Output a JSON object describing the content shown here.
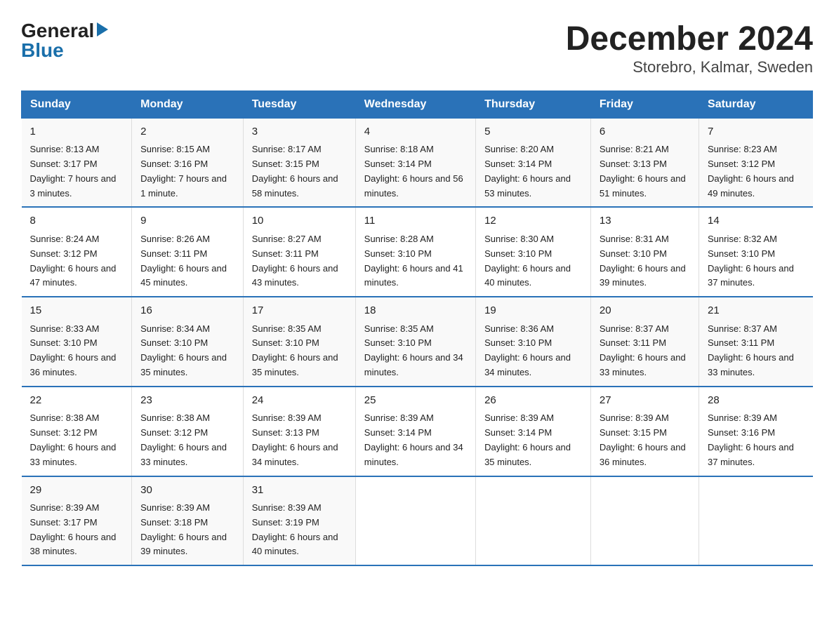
{
  "logo": {
    "general": "General",
    "blue": "Blue"
  },
  "title": "December 2024",
  "subtitle": "Storebro, Kalmar, Sweden",
  "days_of_week": [
    "Sunday",
    "Monday",
    "Tuesday",
    "Wednesday",
    "Thursday",
    "Friday",
    "Saturday"
  ],
  "weeks": [
    [
      {
        "day": "1",
        "sunrise": "8:13 AM",
        "sunset": "3:17 PM",
        "daylight": "7 hours and 3 minutes."
      },
      {
        "day": "2",
        "sunrise": "8:15 AM",
        "sunset": "3:16 PM",
        "daylight": "7 hours and 1 minute."
      },
      {
        "day": "3",
        "sunrise": "8:17 AM",
        "sunset": "3:15 PM",
        "daylight": "6 hours and 58 minutes."
      },
      {
        "day": "4",
        "sunrise": "8:18 AM",
        "sunset": "3:14 PM",
        "daylight": "6 hours and 56 minutes."
      },
      {
        "day": "5",
        "sunrise": "8:20 AM",
        "sunset": "3:14 PM",
        "daylight": "6 hours and 53 minutes."
      },
      {
        "day": "6",
        "sunrise": "8:21 AM",
        "sunset": "3:13 PM",
        "daylight": "6 hours and 51 minutes."
      },
      {
        "day": "7",
        "sunrise": "8:23 AM",
        "sunset": "3:12 PM",
        "daylight": "6 hours and 49 minutes."
      }
    ],
    [
      {
        "day": "8",
        "sunrise": "8:24 AM",
        "sunset": "3:12 PM",
        "daylight": "6 hours and 47 minutes."
      },
      {
        "day": "9",
        "sunrise": "8:26 AM",
        "sunset": "3:11 PM",
        "daylight": "6 hours and 45 minutes."
      },
      {
        "day": "10",
        "sunrise": "8:27 AM",
        "sunset": "3:11 PM",
        "daylight": "6 hours and 43 minutes."
      },
      {
        "day": "11",
        "sunrise": "8:28 AM",
        "sunset": "3:10 PM",
        "daylight": "6 hours and 41 minutes."
      },
      {
        "day": "12",
        "sunrise": "8:30 AM",
        "sunset": "3:10 PM",
        "daylight": "6 hours and 40 minutes."
      },
      {
        "day": "13",
        "sunrise": "8:31 AM",
        "sunset": "3:10 PM",
        "daylight": "6 hours and 39 minutes."
      },
      {
        "day": "14",
        "sunrise": "8:32 AM",
        "sunset": "3:10 PM",
        "daylight": "6 hours and 37 minutes."
      }
    ],
    [
      {
        "day": "15",
        "sunrise": "8:33 AM",
        "sunset": "3:10 PM",
        "daylight": "6 hours and 36 minutes."
      },
      {
        "day": "16",
        "sunrise": "8:34 AM",
        "sunset": "3:10 PM",
        "daylight": "6 hours and 35 minutes."
      },
      {
        "day": "17",
        "sunrise": "8:35 AM",
        "sunset": "3:10 PM",
        "daylight": "6 hours and 35 minutes."
      },
      {
        "day": "18",
        "sunrise": "8:35 AM",
        "sunset": "3:10 PM",
        "daylight": "6 hours and 34 minutes."
      },
      {
        "day": "19",
        "sunrise": "8:36 AM",
        "sunset": "3:10 PM",
        "daylight": "6 hours and 34 minutes."
      },
      {
        "day": "20",
        "sunrise": "8:37 AM",
        "sunset": "3:11 PM",
        "daylight": "6 hours and 33 minutes."
      },
      {
        "day": "21",
        "sunrise": "8:37 AM",
        "sunset": "3:11 PM",
        "daylight": "6 hours and 33 minutes."
      }
    ],
    [
      {
        "day": "22",
        "sunrise": "8:38 AM",
        "sunset": "3:12 PM",
        "daylight": "6 hours and 33 minutes."
      },
      {
        "day": "23",
        "sunrise": "8:38 AM",
        "sunset": "3:12 PM",
        "daylight": "6 hours and 33 minutes."
      },
      {
        "day": "24",
        "sunrise": "8:39 AM",
        "sunset": "3:13 PM",
        "daylight": "6 hours and 34 minutes."
      },
      {
        "day": "25",
        "sunrise": "8:39 AM",
        "sunset": "3:14 PM",
        "daylight": "6 hours and 34 minutes."
      },
      {
        "day": "26",
        "sunrise": "8:39 AM",
        "sunset": "3:14 PM",
        "daylight": "6 hours and 35 minutes."
      },
      {
        "day": "27",
        "sunrise": "8:39 AM",
        "sunset": "3:15 PM",
        "daylight": "6 hours and 36 minutes."
      },
      {
        "day": "28",
        "sunrise": "8:39 AM",
        "sunset": "3:16 PM",
        "daylight": "6 hours and 37 minutes."
      }
    ],
    [
      {
        "day": "29",
        "sunrise": "8:39 AM",
        "sunset": "3:17 PM",
        "daylight": "6 hours and 38 minutes."
      },
      {
        "day": "30",
        "sunrise": "8:39 AM",
        "sunset": "3:18 PM",
        "daylight": "6 hours and 39 minutes."
      },
      {
        "day": "31",
        "sunrise": "8:39 AM",
        "sunset": "3:19 PM",
        "daylight": "6 hours and 40 minutes."
      },
      null,
      null,
      null,
      null
    ]
  ],
  "labels": {
    "sunrise": "Sunrise:",
    "sunset": "Sunset:",
    "daylight": "Daylight:"
  }
}
